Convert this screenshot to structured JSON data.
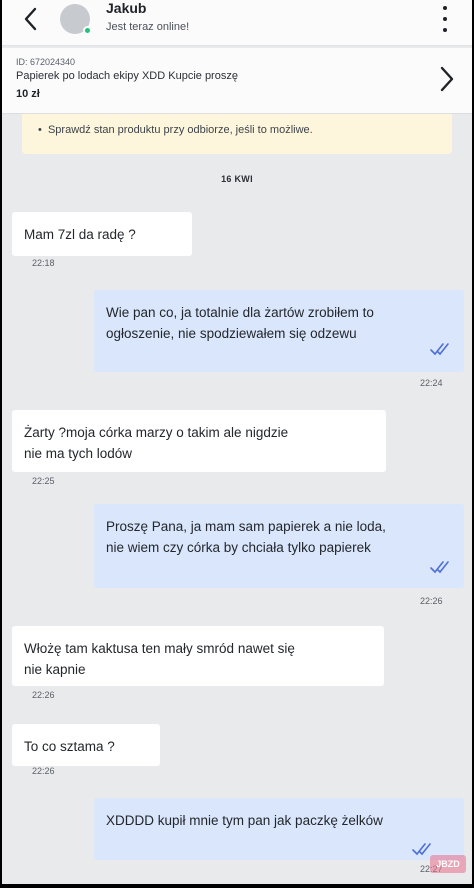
{
  "header": {
    "contact_name": "Jakub",
    "status": "Jest teraz online!"
  },
  "listing": {
    "id_text": "ID: 672024340",
    "title": "Papierek po lodach ekipy XDD Kupcie proszę",
    "price": "10 zł"
  },
  "notice": {
    "text": "Sprawdź stan produktu przy odbiorze, jeśli to możliwe."
  },
  "date_separator": "16 KWI",
  "messages": [
    {
      "direction": "in",
      "lines": [
        "Mam 7zl da radę ?"
      ],
      "time": "22:18"
    },
    {
      "direction": "out",
      "lines": [
        "Wie pan co, ja totalnie dla żartów zrobiłem to",
        "ogłoszenie, nie spodziewałem się odzewu"
      ],
      "time": "22:24"
    },
    {
      "direction": "in",
      "lines": [
        "Żarty ?moja córka marzy o takim ale nigdzie",
        "nie ma tych lodów"
      ],
      "time": "22:25"
    },
    {
      "direction": "out",
      "lines": [
        "Proszę Pana, ja mam sam papierek a nie loda,",
        "nie wiem czy córka by chciała tylko papierek"
      ],
      "time": "22:26"
    },
    {
      "direction": "in",
      "lines": [
        "Włożę tam kaktusa ten mały smród nawet się",
        "nie kapnie"
      ],
      "time": "22:26"
    },
    {
      "direction": "in",
      "lines": [
        "To co sztama ?"
      ],
      "time": "22:26"
    },
    {
      "direction": "out",
      "lines": [
        "XDDDD kupił mnie tym pan jak paczkę żelków"
      ],
      "time": "22:27"
    }
  ],
  "colors": {
    "incoming_bubble": "#ffffff",
    "outgoing_bubble": "#d9e6fb",
    "read_ticks": "#4f6fd8",
    "online_dot": "#25c27a",
    "notice_bg": "#fdf6dc"
  },
  "icons": {
    "back": "chevron-left-icon",
    "menu": "more-vertical-icon",
    "listing_open": "chevron-right-icon",
    "read": "double-check-icon"
  }
}
